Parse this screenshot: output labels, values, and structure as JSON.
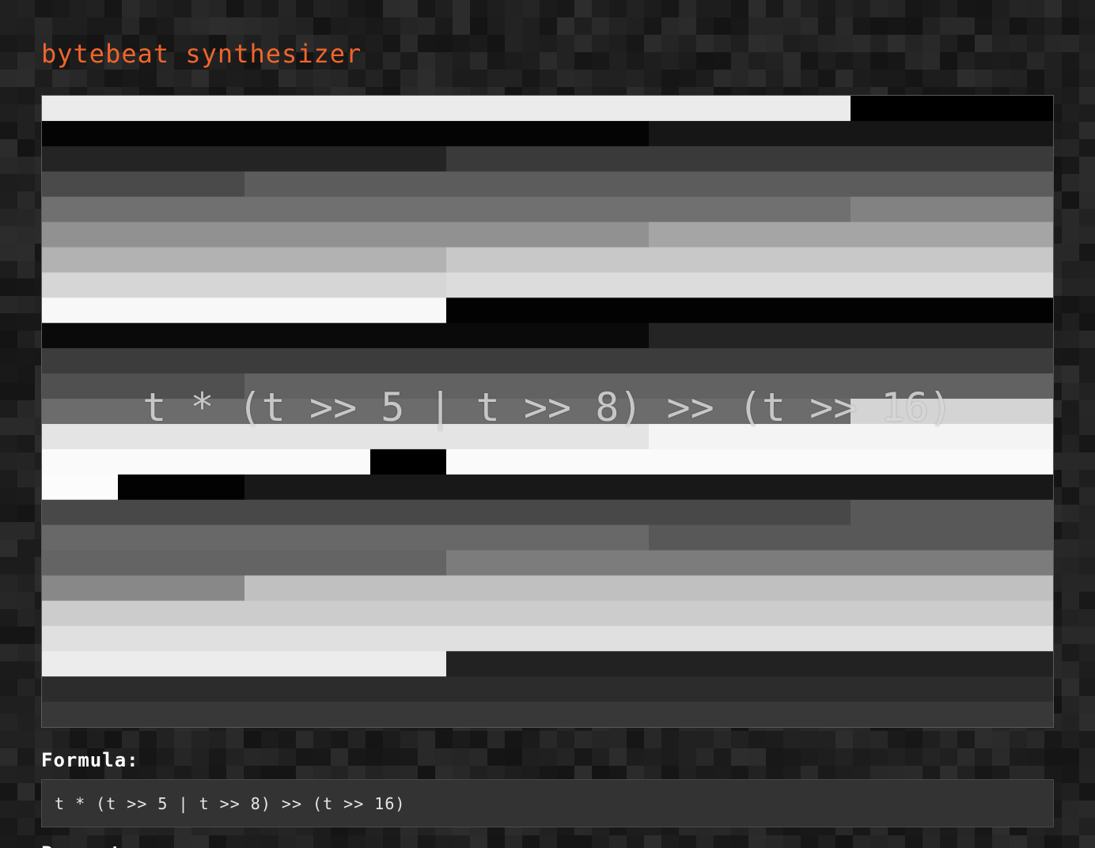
{
  "app": {
    "title": "bytebeat synthesizer",
    "accent_color": "#f0652b"
  },
  "visualizer": {
    "overlay_text": "t * (t >> 5 | t >> 8) >> (t >> 16)",
    "rows": [
      [
        [
          0,
          0.8,
          235
        ],
        [
          0.8,
          1,
          0
        ]
      ],
      [
        [
          0,
          0.6,
          4
        ],
        [
          0.6,
          1,
          22
        ]
      ],
      [
        [
          0,
          0.4,
          36
        ],
        [
          0.4,
          1,
          58
        ]
      ],
      [
        [
          0,
          0.2,
          74
        ],
        [
          0.2,
          1,
          92
        ]
      ],
      [
        [
          0,
          0.8,
          112
        ],
        [
          0.8,
          1,
          130
        ]
      ],
      [
        [
          0,
          0.6,
          145
        ],
        [
          0.6,
          1,
          165
        ]
      ],
      [
        [
          0,
          0.4,
          178
        ],
        [
          0.4,
          1,
          200
        ]
      ],
      [
        [
          0,
          0.4,
          214
        ],
        [
          0.4,
          1,
          220
        ]
      ],
      [
        [
          0,
          0.4,
          248
        ],
        [
          0.4,
          1,
          2
        ]
      ],
      [
        [
          0,
          0.6,
          10
        ],
        [
          0.6,
          1,
          36
        ]
      ],
      [
        [
          0,
          1,
          60
        ]
      ],
      [
        [
          0,
          0.2,
          80
        ],
        [
          0.2,
          1,
          98
        ]
      ],
      [
        [
          0,
          0.8,
          108
        ],
        [
          0.8,
          1,
          212
        ]
      ],
      [
        [
          0,
          0.6,
          228
        ],
        [
          0.6,
          1,
          244
        ]
      ],
      [
        [
          0,
          0.325,
          250
        ],
        [
          0.325,
          0.4,
          0
        ],
        [
          0.4,
          1,
          250
        ]
      ],
      [
        [
          0,
          0.075,
          252
        ],
        [
          0.075,
          0.2,
          2
        ],
        [
          0.2,
          1,
          24
        ]
      ],
      [
        [
          0,
          0.8,
          72
        ],
        [
          0.8,
          1,
          88
        ]
      ],
      [
        [
          0,
          0.6,
          104
        ],
        [
          0.6,
          1,
          88
        ]
      ],
      [
        [
          0,
          0.4,
          100
        ],
        [
          0.4,
          1,
          124
        ]
      ],
      [
        [
          0,
          0.2,
          136
        ],
        [
          0.2,
          1,
          192
        ]
      ],
      [
        [
          0,
          1,
          204
        ]
      ],
      [
        [
          0,
          1,
          224
        ]
      ],
      [
        [
          0,
          0.4,
          236
        ],
        [
          0.4,
          1,
          34
        ]
      ],
      [
        [
          0,
          1,
          44
        ]
      ],
      [
        [
          0,
          1,
          56
        ]
      ]
    ]
  },
  "formula": {
    "label": "Formula:",
    "value": "t * (t >> 5 | t >> 8) >> (t >> 16)"
  },
  "next_section": {
    "label": "Parameters"
  }
}
